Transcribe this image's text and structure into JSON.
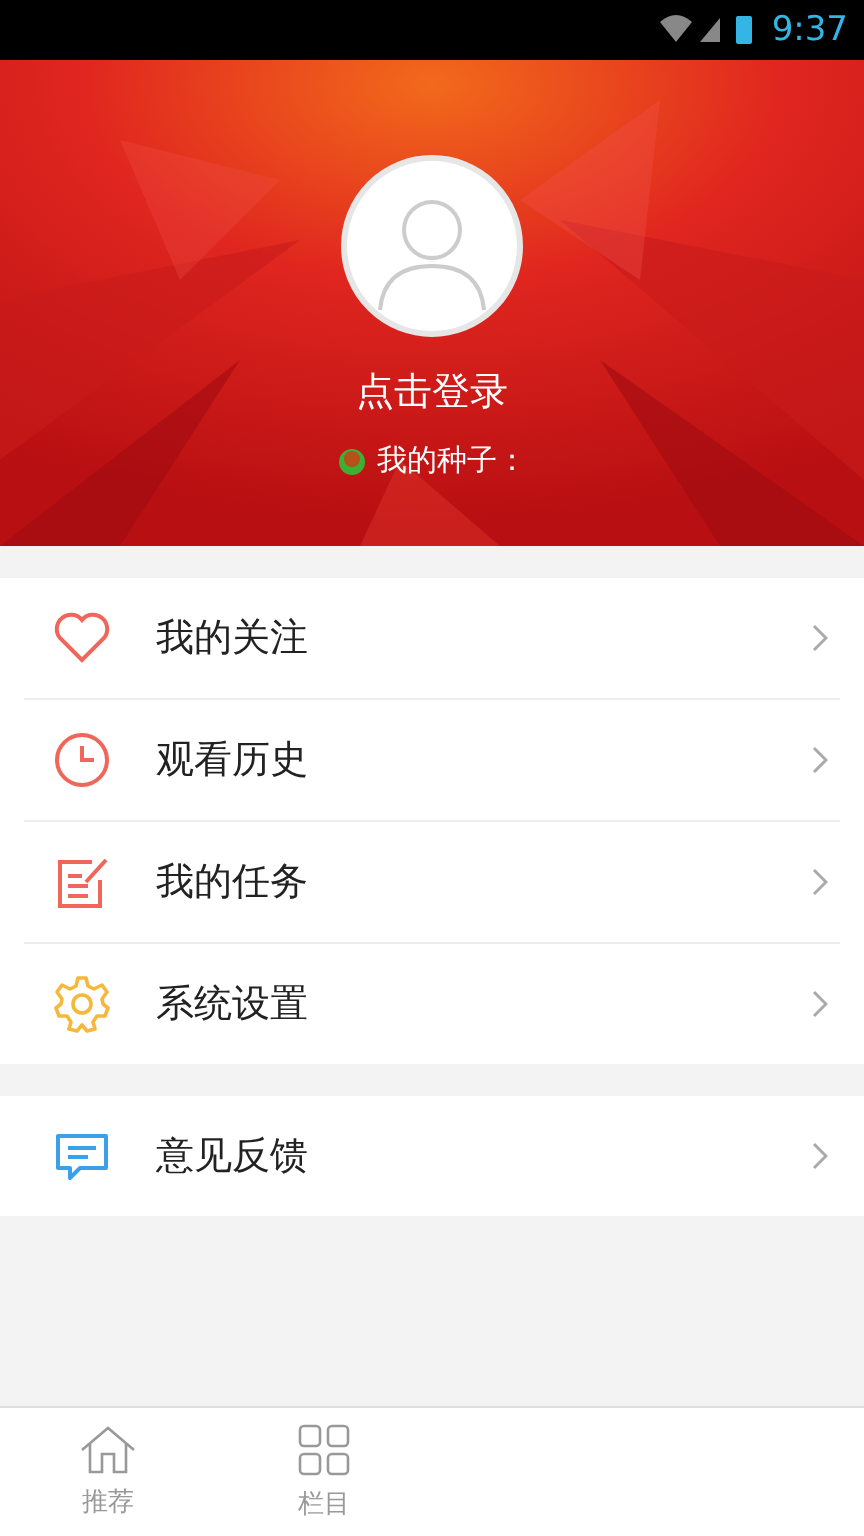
{
  "status_bar": {
    "time": "9:37"
  },
  "profile": {
    "login": "点击登录",
    "seeds_label": "我的种子："
  },
  "menu_groups": [
    {
      "items": [
        {
          "label": "我的关注"
        },
        {
          "label": "观看历史"
        },
        {
          "label": "我的任务"
        },
        {
          "label": "系统设置"
        }
      ]
    },
    {
      "items": [
        {
          "label": "意见反馈"
        }
      ]
    }
  ],
  "tab_bar": [
    {
      "label": "推荐",
      "selected": false
    },
    {
      "label": "栏目",
      "selected": false
    }
  ]
}
